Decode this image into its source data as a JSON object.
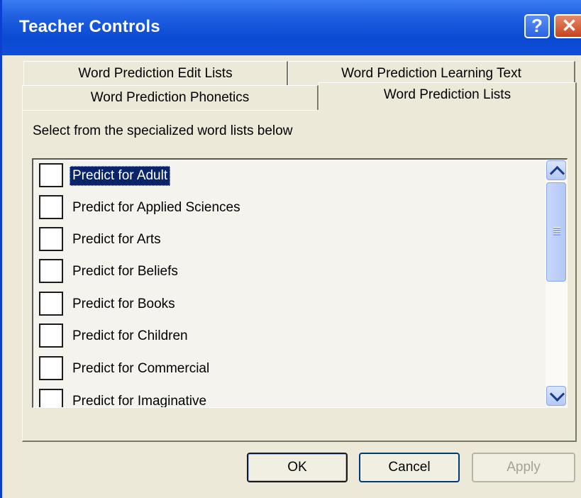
{
  "window": {
    "title": "Teacher Controls",
    "help_label": "?",
    "close_label": "✕"
  },
  "tabs": {
    "back": [
      "Word Prediction Edit Lists",
      "Word Prediction Learning Text"
    ],
    "front": [
      "Word Prediction Phonetics",
      "Word Prediction Lists"
    ],
    "selected": "Word Prediction Lists"
  },
  "panel": {
    "instruction": "Select from the specialized word lists below",
    "items": [
      {
        "label": "Predict for Adult",
        "checked": false,
        "selected": true
      },
      {
        "label": "Predict for Applied Sciences",
        "checked": false
      },
      {
        "label": "Predict for Arts",
        "checked": false
      },
      {
        "label": "Predict for Beliefs",
        "checked": false
      },
      {
        "label": "Predict for Books",
        "checked": false
      },
      {
        "label": "Predict for Children",
        "checked": false
      },
      {
        "label": "Predict for Commercial",
        "checked": false
      },
      {
        "label": "Predict for Imaginative",
        "checked": false
      }
    ]
  },
  "buttons": {
    "ok": "OK",
    "cancel": "Cancel",
    "apply": "Apply"
  },
  "icons": {
    "scroll_up": "chevron-up-icon",
    "scroll_down": "chevron-down-icon"
  },
  "colors": {
    "titlebar": "#0a49d2",
    "selection": "#0a246a",
    "dialog": "#ece9d8"
  }
}
